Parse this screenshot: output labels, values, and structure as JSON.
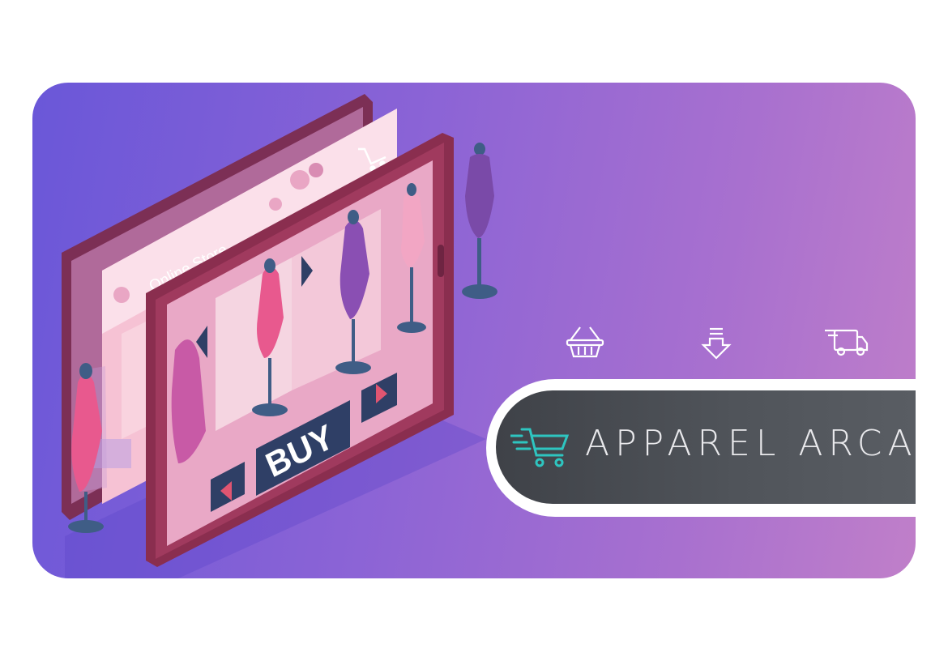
{
  "illustration": {
    "store_label": "Online Store",
    "buy_label": "BUY"
  },
  "feature_icons": [
    "basket-icon",
    "download-arrow-icon",
    "delivery-truck-icon"
  ],
  "brand": {
    "name": "APPAREL ARCADE",
    "logo_icon": "shopping-cart-icon"
  },
  "colors": {
    "banner_start": "#6a57d8",
    "banner_end": "#c07fc9",
    "pill_dark": "#4a4d53",
    "cart_accent": "#2ec5c0",
    "frame_maroon": "#8a2e4f",
    "screen_pink": "#f7c6d6"
  }
}
